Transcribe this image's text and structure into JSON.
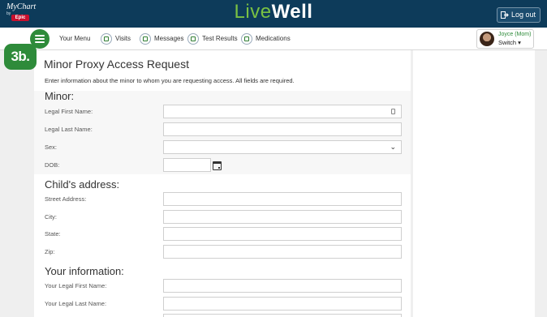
{
  "header": {
    "mychart_logo_text": "MyChart",
    "mychart_by": "by",
    "epic_text": "Epic",
    "brand_live": "Live",
    "brand_well": "Well",
    "logout_label": "Log out"
  },
  "nav": {
    "menu_label": "Your Menu",
    "items": [
      {
        "label": "Visits",
        "icon": "visits-icon"
      },
      {
        "label": "Messages",
        "icon": "messages-icon"
      },
      {
        "label": "Test Results",
        "icon": "test-results-icon"
      },
      {
        "label": "Medications",
        "icon": "medications-icon"
      }
    ],
    "user": {
      "name": "Joyce (Mom)",
      "switch_label": "Switch ▾"
    }
  },
  "step_badge": "3b.",
  "form": {
    "title": "Minor Proxy Access Request",
    "intro": "Enter information about the minor to whom you are requesting access. All fields are required.",
    "minor": {
      "heading": "Minor:",
      "first_name_label": "Legal First Name:",
      "last_name_label": "Legal Last Name:",
      "sex_label": "Sex:",
      "dob_label": "DOB:"
    },
    "address": {
      "heading": "Child's address:",
      "street_label": "Street Address:",
      "city_label": "City:",
      "state_label": "State:",
      "zip_label": "Zip:"
    },
    "yours": {
      "heading": "Your information:",
      "first_name_label": "Your Legal First Name:",
      "last_name_label": "Your Legal Last Name:"
    }
  },
  "colors": {
    "header_bg": "#0d3b5a",
    "brand_green": "#2e8b3a",
    "live_green": "#7ac143"
  }
}
